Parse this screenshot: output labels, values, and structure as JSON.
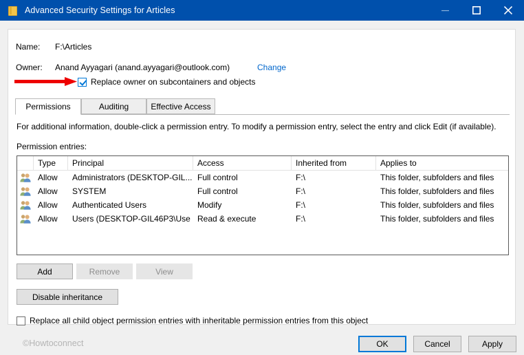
{
  "window": {
    "title": "Advanced Security Settings for Articles",
    "icon": "folder-icon",
    "titlebar_color": "#0050ac",
    "controls": {
      "minimize": "minimize-icon",
      "maximize": "maximize-icon",
      "close": "close-icon"
    }
  },
  "header": {
    "name_label": "Name:",
    "name_value": "F:\\Articles",
    "owner_label": "Owner:",
    "owner_value": "Anand Ayyagari (anand.ayyagari@outlook.com)",
    "change_link": "Change",
    "change_link_color": "#0066cc",
    "replace_owner_checkbox": {
      "label": "Replace owner on subcontainers and objects",
      "checked": true
    },
    "annotation": {
      "type": "arrow",
      "color": "#ee0000",
      "points_to": "replace-owner-checkbox"
    }
  },
  "tabs": [
    {
      "label": "Permissions",
      "active": true
    },
    {
      "label": "Auditing",
      "active": false
    },
    {
      "label": "Effective Access",
      "active": false
    }
  ],
  "permissions": {
    "info_text": "For additional information, double-click a permission entry. To modify a permission entry, select the entry and click Edit (if available).",
    "entries_label": "Permission entries:",
    "columns": [
      "Type",
      "Principal",
      "Access",
      "Inherited from",
      "Applies to"
    ],
    "rows": [
      {
        "icon": "users-group-icon",
        "type": "Allow",
        "principal": "Administrators (DESKTOP-GIL...",
        "access": "Full control",
        "inherited_from": "F:\\",
        "applies_to": "This folder, subfolders and files"
      },
      {
        "icon": "users-group-icon",
        "type": "Allow",
        "principal": "SYSTEM",
        "access": "Full control",
        "inherited_from": "F:\\",
        "applies_to": "This folder, subfolders and files"
      },
      {
        "icon": "users-group-icon",
        "type": "Allow",
        "principal": "Authenticated Users",
        "access": "Modify",
        "inherited_from": "F:\\",
        "applies_to": "This folder, subfolders and files"
      },
      {
        "icon": "users-group-icon",
        "type": "Allow",
        "principal": "Users (DESKTOP-GIL46P3\\Use",
        "access": "Read & execute",
        "inherited_from": "F:\\",
        "applies_to": "This folder, subfolders and files"
      }
    ],
    "buttons": {
      "add": "Add",
      "remove": "Remove",
      "view": "View",
      "disable_inheritance": "Disable inheritance"
    },
    "replace_all_checkbox": {
      "label": "Replace all child object permission entries with inheritable permission entries from this object",
      "checked": false
    }
  },
  "footer": {
    "watermark": "©Howtoconnect",
    "ok": "OK",
    "cancel": "Cancel",
    "apply": "Apply",
    "default_button_color": "#0078d7"
  }
}
